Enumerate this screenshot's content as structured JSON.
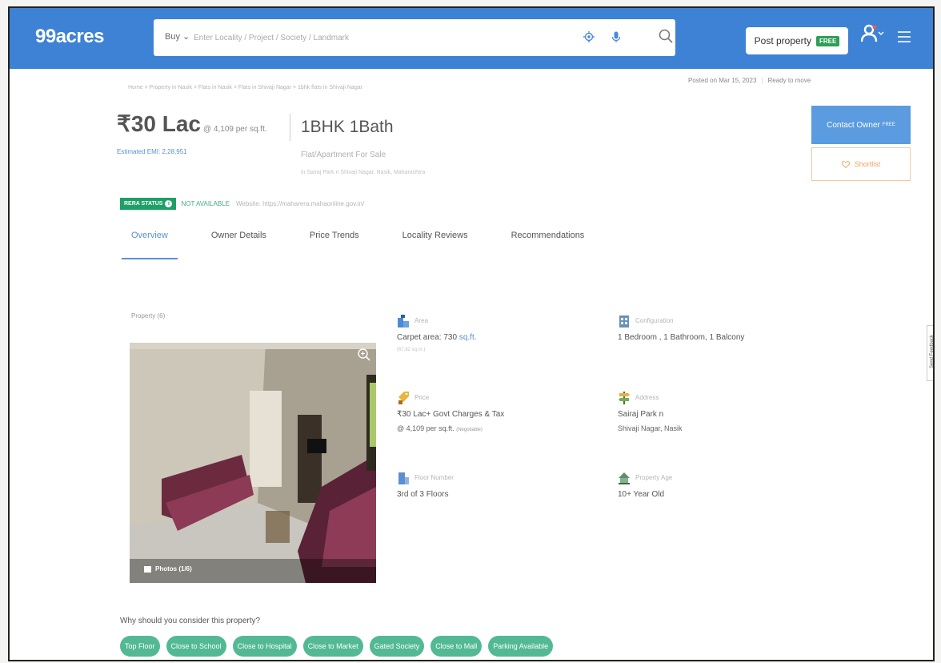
{
  "header": {
    "logo": "99acres",
    "search": {
      "buy_label": "Buy",
      "placeholder": "Enter Locality / Project / Society / Landmark"
    },
    "post_property": {
      "label": "Post property",
      "badge": "FREE"
    }
  },
  "breadcrumb": "Home > Property in Nasik > Flats in Nasik > Flats in Shivaji Nagar > 1bhk flats in Shivaji Nagar",
  "posted": {
    "date": "Posted on Mar 15, 2023",
    "status": "Ready to move"
  },
  "listing": {
    "price": "₹30 Lac",
    "price_per_sqft": "@ 4,109 per sq.ft.",
    "emi": "Estimated EMI: 2,28,951",
    "title": "1BHK 1Bath",
    "subtitle": "Flat/Apartment For Sale",
    "address_line": "in Sairaj Park n Shivaji Nagar, Nasik, Maharashtra"
  },
  "actions": {
    "contact_owner": "Contact Owner",
    "contact_badge": "FREE",
    "shortlist": "Shortlist"
  },
  "rera": {
    "badge": "RERA STATUS",
    "status": "NOT AVAILABLE",
    "website": "Website: https://maharera.mahaonline.gov.in/"
  },
  "tabs": [
    "Overview",
    "Owner Details",
    "Price Trends",
    "Locality Reviews",
    "Recommendations"
  ],
  "active_tab": "Overview",
  "photos": {
    "section_label": "Property (6)",
    "badge": "Photos (1/6)"
  },
  "details": {
    "area": {
      "label": "Area",
      "value": "Carpet area: 730",
      "unit": "sq.ft.",
      "note": "(67.82 sq.m.)"
    },
    "configuration": {
      "label": "Configuration",
      "value": "1 Bedroom , 1 Bathroom, 1 Balcony"
    },
    "price": {
      "label": "Price",
      "value": "₹30 Lac+ Govt Charges & Tax",
      "value2": "@ 4,109 per sq.ft.",
      "note": "(Negotiable)"
    },
    "address": {
      "label": "Address",
      "value": "Sairaj Park n",
      "value2": "Shivaji Nagar, Nasik"
    },
    "floor": {
      "label": "Floor Number",
      "value": "3rd  of 3 Floors"
    },
    "age": {
      "label": "Property Age",
      "value": "10+ Year Old"
    }
  },
  "feedback": "Send Feedback",
  "why": {
    "heading": "Why should you consider this property?",
    "chips": [
      "Top Floor",
      "Close to School",
      "Close to Hospital",
      "Close to Market",
      "Gated Society",
      "Close to Mall",
      "Parking Available"
    ]
  },
  "colors": {
    "header_bg": "#3d82d4",
    "accent_blue": "#5a8fd6",
    "chip_green": "#52b994",
    "rera_green": "#1e9f67",
    "shortlist_orange": "#f0a460"
  }
}
